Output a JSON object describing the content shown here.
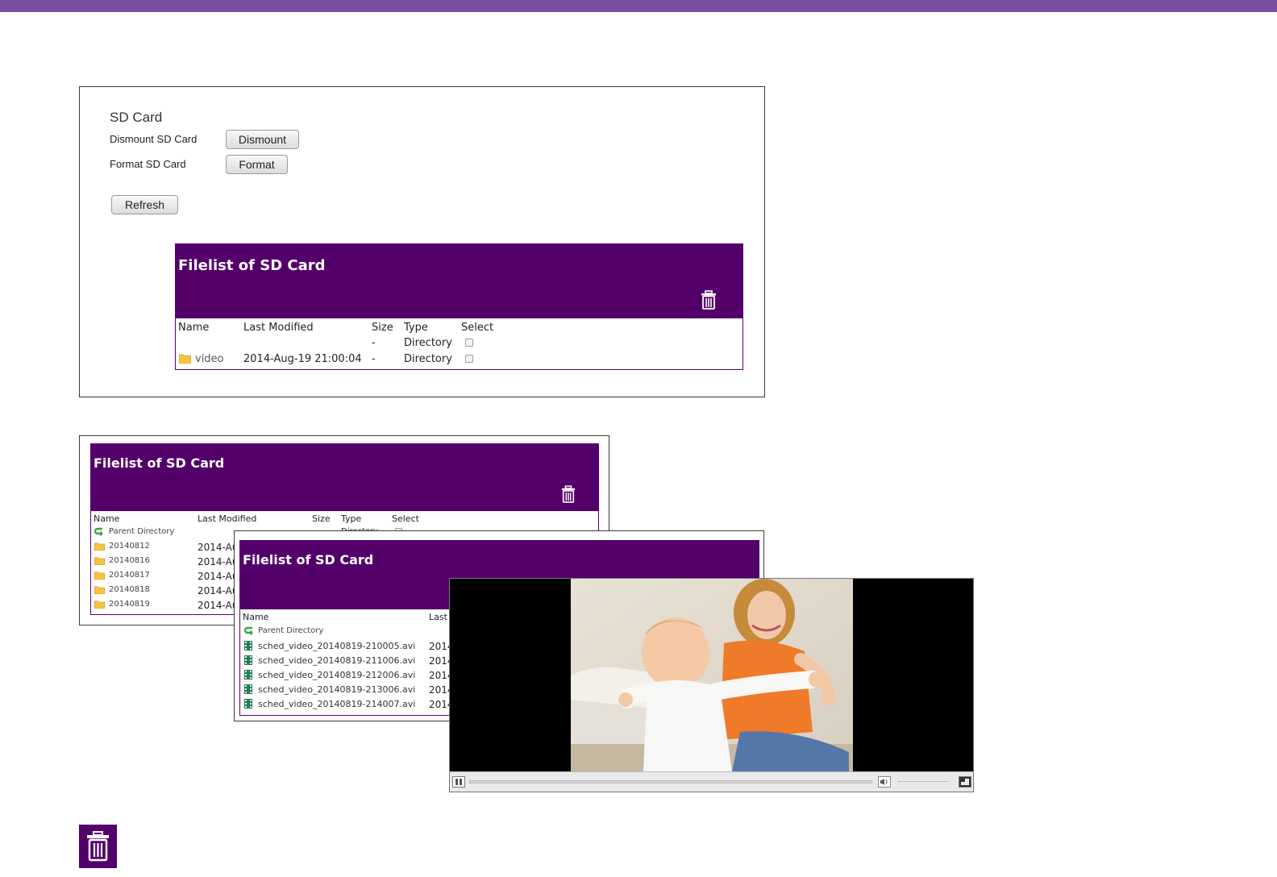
{
  "sd_card": {
    "title": "SD Card",
    "dismount_label": "Dismount SD Card",
    "dismount_button": "Dismount",
    "format_label": "Format SD Card",
    "format_button": "Format",
    "refresh_button": "Refresh"
  },
  "filelist_root": {
    "title": "Filelist of SD Card",
    "columns": [
      "Name",
      "Last Modified",
      "Size",
      "Type",
      "Select"
    ],
    "rows": [
      {
        "name": "",
        "modified": "",
        "size": "-",
        "type": "Directory"
      },
      {
        "name": "video",
        "modified": "2014-Aug-19 21:00:04",
        "size": "-",
        "type": "Directory"
      }
    ]
  },
  "filelist_video": {
    "title": "Filelist of SD Card",
    "columns": [
      "Name",
      "Last Modified",
      "Size",
      "Type",
      "Select"
    ],
    "parent": "Parent Directory",
    "parent_type": "Directory",
    "rows": [
      {
        "name": "20140812",
        "modified": "2014-Au"
      },
      {
        "name": "20140816",
        "modified": "2014-Au"
      },
      {
        "name": "20140817",
        "modified": "2014-Au"
      },
      {
        "name": "20140818",
        "modified": "2014-Au"
      },
      {
        "name": "20140819",
        "modified": "2014-Au"
      }
    ]
  },
  "filelist_day": {
    "title": "Filelist of SD Card",
    "columns": [
      "Name",
      "Last"
    ],
    "parent": "Parent Directory",
    "rows": [
      {
        "name": "sched_video_20140819-210005.avi",
        "modified": "2014"
      },
      {
        "name": "sched_video_20140819-211006.avi",
        "modified": "2014"
      },
      {
        "name": "sched_video_20140819-212006.avi",
        "modified": "2014"
      },
      {
        "name": "sched_video_20140819-213006.avi",
        "modified": "2014"
      },
      {
        "name": "sched_video_20140819-214007.avi",
        "modified": "2014"
      }
    ]
  },
  "player": {
    "progress": 0.0,
    "icons": [
      "pause-icon",
      "volume-icon",
      "fullscreen-icon"
    ]
  },
  "colors": {
    "header_purple": "#54006b",
    "top_bar": "#7a4fa0",
    "folder_yellow": "#f3c543",
    "parent_green": "#3ea34a"
  },
  "icons": {
    "trash": "trash-icon",
    "folder": "folder-icon",
    "parent": "parent-directory-icon",
    "video_file": "video-file-icon"
  }
}
